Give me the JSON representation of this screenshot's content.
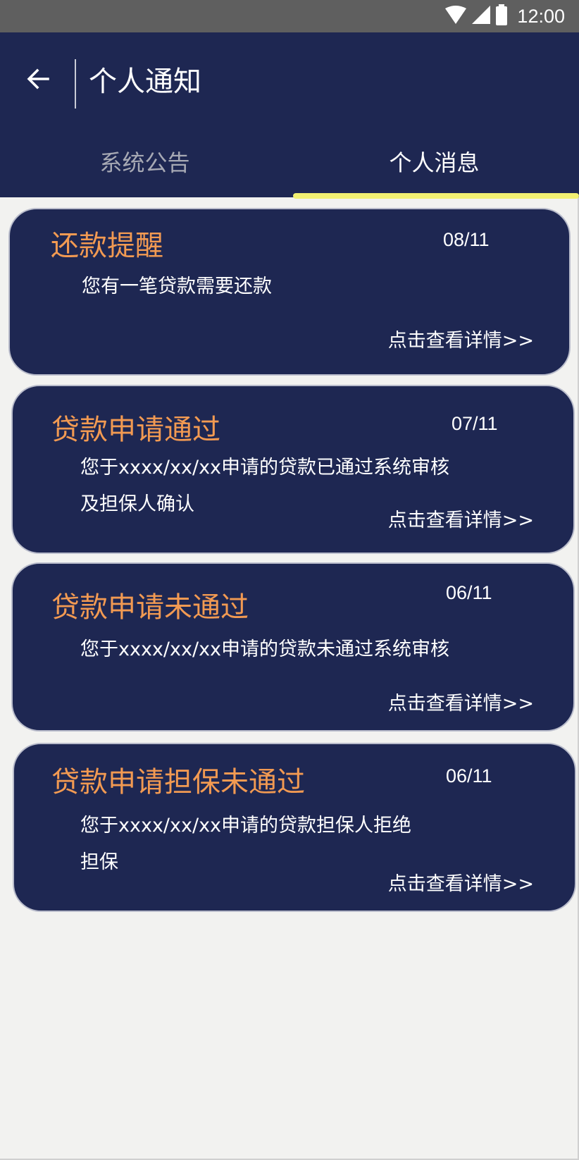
{
  "status_bar": {
    "time": "12:00",
    "icons": [
      "wifi-icon",
      "signal-icon",
      "battery-icon"
    ]
  },
  "header": {
    "title": "个人通知",
    "back_icon": "arrow-left-icon"
  },
  "tabs": [
    {
      "label": "系统公告",
      "active": false
    },
    {
      "label": "个人消息",
      "active": true
    }
  ],
  "colors": {
    "primary": "#1e2752",
    "accent_title": "#f29a52",
    "tab_indicator": "#f2f072",
    "background": "#f2f2f0"
  },
  "notifications": [
    {
      "title": "还款提醒",
      "date": "08/11",
      "body": "您有一笔贷款需要还款",
      "link": "点击查看详情>>"
    },
    {
      "title": "贷款申请通过",
      "date": "07/11",
      "body_lines": [
        "您于xxxx/xx/xx申请的贷款已通过系统审核",
        "及担保人确认"
      ],
      "link": "点击查看详情>>"
    },
    {
      "title": "贷款申请未通过",
      "date": "06/11",
      "body": "您于xxxx/xx/xx申请的贷款未通过系统审核",
      "link": "点击查看详情>>"
    },
    {
      "title": "贷款申请担保未通过",
      "date": "06/11",
      "body_lines": [
        "您于xxxx/xx/xx申请的贷款担保人拒绝",
        "担保"
      ],
      "link": "点击查看详情>>"
    }
  ]
}
